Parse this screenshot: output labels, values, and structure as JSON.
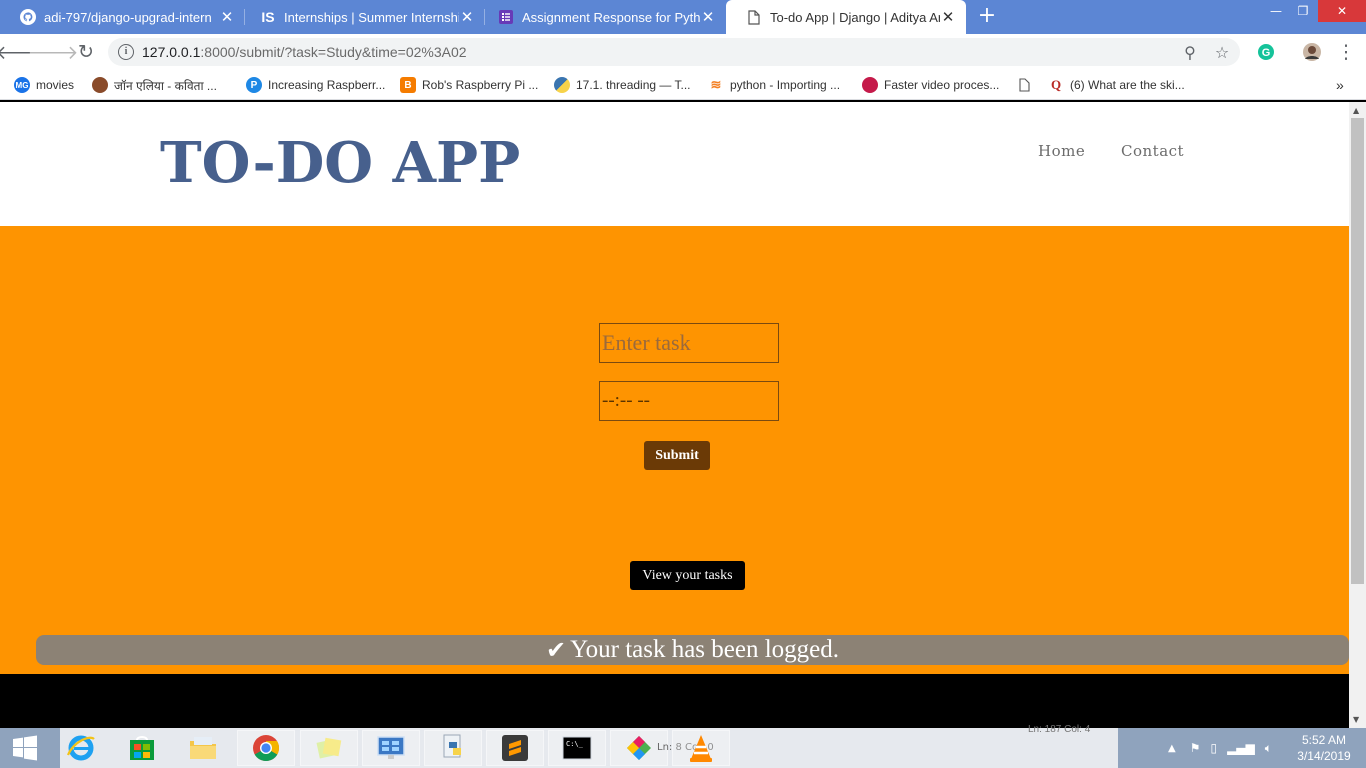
{
  "browser": {
    "tabs": [
      {
        "title": "adi-797/django-upgrad-intern",
        "icon": "github-icon"
      },
      {
        "title": "Internships | Summer Internship",
        "icon": "internshala-icon"
      },
      {
        "title": "Assignment Response for Python",
        "icon": "form-icon"
      },
      {
        "title": "To-do App | Django | Aditya Aro",
        "icon": "page-icon",
        "active": true
      }
    ],
    "url_host": "127.0.0.1",
    "url_rest": ":8000/submit/?task=Study&time=02%3A02",
    "bookmarks": [
      {
        "label": "movies",
        "icon": "mg-icon",
        "color": "#1a73e8"
      },
      {
        "label": "जॉन एलिया - कविता ...",
        "icon": "avatar-icon",
        "color": "#8a4b2a"
      },
      {
        "label": "Increasing Raspberr...",
        "icon": "p-icon",
        "color": "#1e88e5"
      },
      {
        "label": "Rob's Raspberry Pi ...",
        "icon": "blogger-icon",
        "color": "#f57c00"
      },
      {
        "label": "17.1. threading — T...",
        "icon": "python-icon",
        "color": "#3a75b0"
      },
      {
        "label": "python - Importing ...",
        "icon": "stackoverflow-icon",
        "color": "#f48024"
      },
      {
        "label": "Faster video proces...",
        "icon": "raspberry-icon",
        "color": "#c51a4a"
      },
      {
        "label": "",
        "icon": "page-icon",
        "color": "#ffffff"
      },
      {
        "label": "(6) What are the ski...",
        "icon": "quora-icon",
        "color": "#b92b27"
      }
    ]
  },
  "page": {
    "logo": "TO-DO APP",
    "nav": {
      "home": "Home",
      "contact": "Contact"
    },
    "form": {
      "task_placeholder": "Enter task",
      "time_value": "--:-- --",
      "submit_label": "Submit"
    },
    "view_tasks_label": "View your tasks",
    "alert_message": "Your task has been logged."
  },
  "taskbar": {
    "clock_time": "5:52 AM",
    "clock_date": "3/14/2019",
    "ghost_status": "Ln: 187   Col: 4",
    "ghost_status2": "Ln: 8   Col: 0"
  },
  "colors": {
    "accent_orange": "#fe9401",
    "logo_blue": "#47608d",
    "submit_brown": "#6b3a06",
    "alert_gray": "#8c8275"
  }
}
